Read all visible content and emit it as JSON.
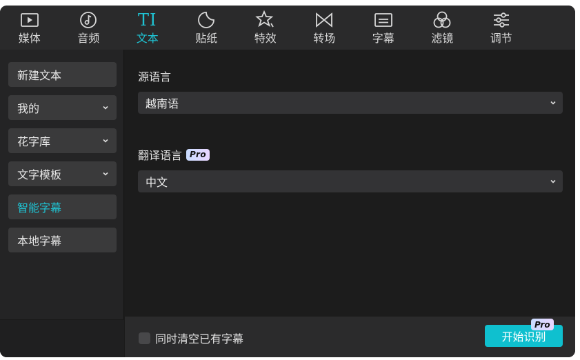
{
  "toolbar": {
    "items": [
      {
        "label": "媒体",
        "icon": "media-play-icon"
      },
      {
        "label": "音频",
        "icon": "audio-note-icon"
      },
      {
        "label": "文本",
        "icon": "text-ti-icon",
        "glyph": "TI",
        "active": true
      },
      {
        "label": "贴纸",
        "icon": "sticker-icon"
      },
      {
        "label": "特效",
        "icon": "effects-star-icon"
      },
      {
        "label": "转场",
        "icon": "transition-bowtie-icon"
      },
      {
        "label": "字幕",
        "icon": "subtitle-icon"
      },
      {
        "label": "滤镜",
        "icon": "filter-circles-icon"
      },
      {
        "label": "调节",
        "icon": "adjust-sliders-icon"
      }
    ]
  },
  "sidebar": {
    "items": [
      {
        "label": "新建文本"
      },
      {
        "label": "我的"
      },
      {
        "label": "花字库"
      },
      {
        "label": "文字模板"
      },
      {
        "label": "智能字幕",
        "active": true
      },
      {
        "label": "本地字幕"
      }
    ]
  },
  "main": {
    "source_label": "源语言",
    "source_value": "越南语",
    "target_label": "翻译语言",
    "target_badge": "Pro",
    "target_value": "中文"
  },
  "bottom": {
    "checkbox_label": "同时清空已有字幕",
    "checkbox_checked": false,
    "start_label": "开始识别",
    "start_badge": "Pro"
  },
  "colors": {
    "accent": "#1fc3d3",
    "button": "#0fc0cf",
    "background": "#1b1b1b"
  }
}
